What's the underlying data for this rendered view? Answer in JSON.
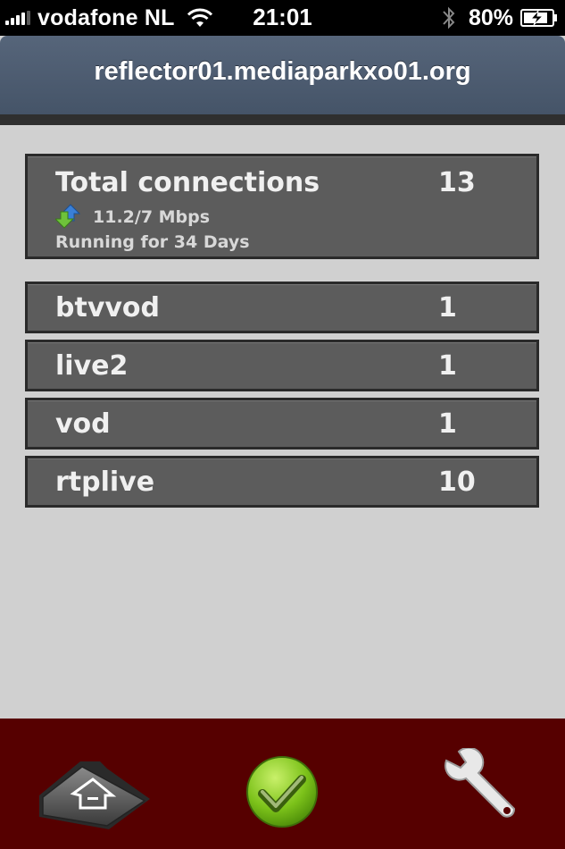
{
  "status_bar": {
    "carrier": "vodafone NL",
    "time": "21:01",
    "battery": "80%",
    "icons": [
      "signal-icon",
      "wifi-icon",
      "bluetooth-icon",
      "battery-charging-icon"
    ]
  },
  "header": {
    "title": "reflector01.mediaparkxo01.org"
  },
  "summary": {
    "label": "Total connections",
    "count": "13",
    "bandwidth": "11.2/7 Mbps",
    "uptime": "Running for 34 Days",
    "icon": "up-down-arrows-icon"
  },
  "applications": [
    {
      "name": "btvvod",
      "count": "1"
    },
    {
      "name": "live2",
      "count": "1"
    },
    {
      "name": "vod",
      "count": "1"
    },
    {
      "name": "rtplive",
      "count": "10"
    }
  ],
  "tabbar": {
    "items": [
      "home-folder-icon",
      "checkmark-icon",
      "wrench-icon"
    ]
  },
  "colors": {
    "header": "#4a5a6e",
    "card": "#5c5c5c",
    "background": "#d0d0d0",
    "tabbar": "#560000",
    "check_green": "#7cc21a"
  }
}
